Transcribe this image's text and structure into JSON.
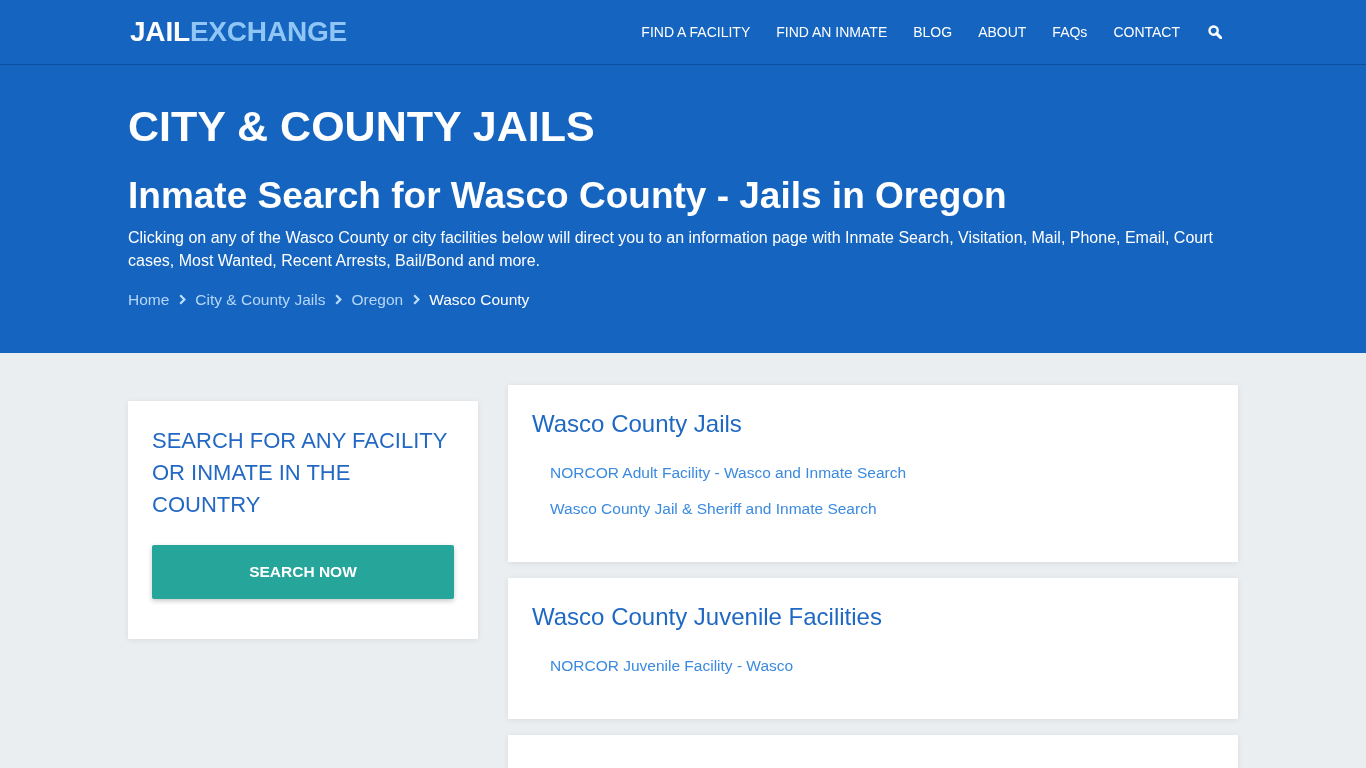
{
  "header": {
    "logo": {
      "primary": "JAIL",
      "accent": "EXCHANGE"
    },
    "nav": [
      "FIND A FACILITY",
      "FIND AN INMATE",
      "BLOG",
      "ABOUT",
      "FAQs",
      "CONTACT"
    ]
  },
  "hero": {
    "section_title": "CITY & COUNTY JAILS",
    "title": "Inmate Search for Wasco County - Jails in Oregon",
    "description": "Clicking on any of the Wasco County or city facilities below will direct you to an information page with Inmate Search, Visitation, Mail, Phone, Email, Court cases, Most Wanted, Recent Arrests, Bail/Bond and more.",
    "breadcrumb": [
      {
        "label": "Home",
        "current": false
      },
      {
        "label": "City & County Jails",
        "current": false
      },
      {
        "label": "Oregon",
        "current": false
      },
      {
        "label": "Wasco County",
        "current": true
      }
    ]
  },
  "sidebar": {
    "promo_title": "SEARCH FOR ANY FACILITY OR INMATE IN THE COUNTRY",
    "button": "SEARCH NOW"
  },
  "sections": [
    {
      "title": "Wasco County Jails",
      "links": [
        "NORCOR Adult Facility - Wasco and Inmate Search",
        "Wasco County Jail & Sheriff and Inmate Search"
      ]
    },
    {
      "title": "Wasco County Juvenile Facilities",
      "links": [
        "NORCOR Juvenile Facility - Wasco"
      ]
    }
  ],
  "more_below": true
}
